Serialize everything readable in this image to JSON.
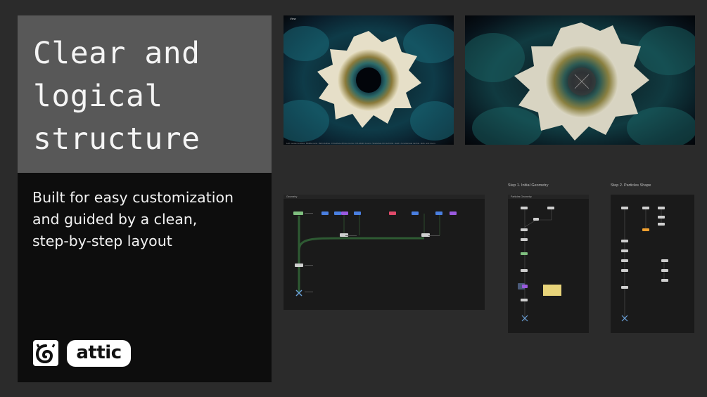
{
  "hero": {
    "title_lines": [
      "Clear and",
      "logical",
      "structure"
    ],
    "subtitle_lines": [
      "Built for easy customization",
      "and guided by a clean,",
      "step-by-step layout"
    ],
    "brand": "attic"
  },
  "viewports": {
    "view1_label": "View",
    "view1_status": "Left mouse tumbles. Middle pans. Right dollies. Ctrl+Alt+Left box-zooms. Ctrl+Right zooms. Spacebar-Ctrl-Left tilts. Hold L for alternate tumble, dolly, and zoom."
  },
  "panels": {
    "main_label": "Geometry",
    "step1_title": "Step 1. Initial Geometry",
    "step1_label": "Particles Geometry",
    "step2_title": "Step 2. Particles Shape"
  },
  "colors": {
    "background": "#2b2b2b",
    "hero_top": "#585858",
    "hero_bottom": "#0d0d0d",
    "panel": "#1a1a1a",
    "node_green": "#7fbf7f",
    "node_blue": "#4a7fe0",
    "node_purple": "#9a5adf",
    "node_red": "#e04a6a",
    "node_yellow": "#e8d47a",
    "node_orange": "#f0a030"
  },
  "icons": [
    "houdini-logo-icon"
  ]
}
